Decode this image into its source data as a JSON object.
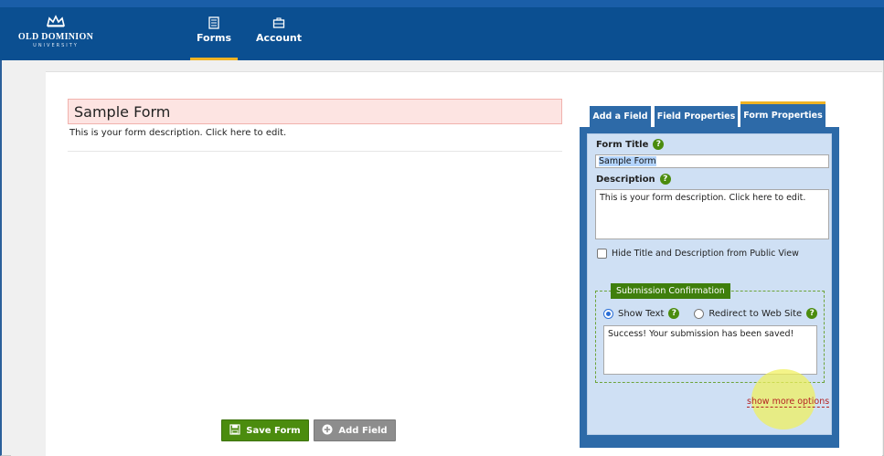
{
  "header": {
    "logo_name": "OLD DOMINION",
    "logo_sub": "UNIVERSITY",
    "nav": [
      {
        "label": "Forms",
        "icon": "forms-icon",
        "active": true
      },
      {
        "label": "Account",
        "icon": "briefcase-icon",
        "active": false
      }
    ]
  },
  "form": {
    "title": "Sample Form",
    "description": "This is your form description. Click here to edit."
  },
  "buttons": {
    "save_label": "Save Form",
    "add_label": "Add Field"
  },
  "tabs": [
    {
      "label": "Add a Field"
    },
    {
      "label": "Field Properties"
    },
    {
      "label": "Form Properties",
      "active": true
    }
  ],
  "properties": {
    "form_title_label": "Form Title",
    "form_title_value": "Sample Form",
    "description_label": "Description",
    "description_value": "This is your form description. Click here to edit.",
    "hide_label": "Hide Title and Description from Public View",
    "submission_legend": "Submission Confirmation",
    "show_text_label": "Show Text",
    "redirect_label": "Redirect to Web Site",
    "confirmation_value": "Success! Your submission has been saved!",
    "more_options_label": "show more options"
  },
  "help_glyph": "?",
  "colors": {
    "nav_bg": "#0b4f91",
    "accent_gold": "#f0b323",
    "panel_blue": "#2d6aa8",
    "panel_light": "#cfe0f4",
    "green": "#4b8c0e",
    "title_bg": "#fde4e2",
    "link_red": "#b52424"
  }
}
